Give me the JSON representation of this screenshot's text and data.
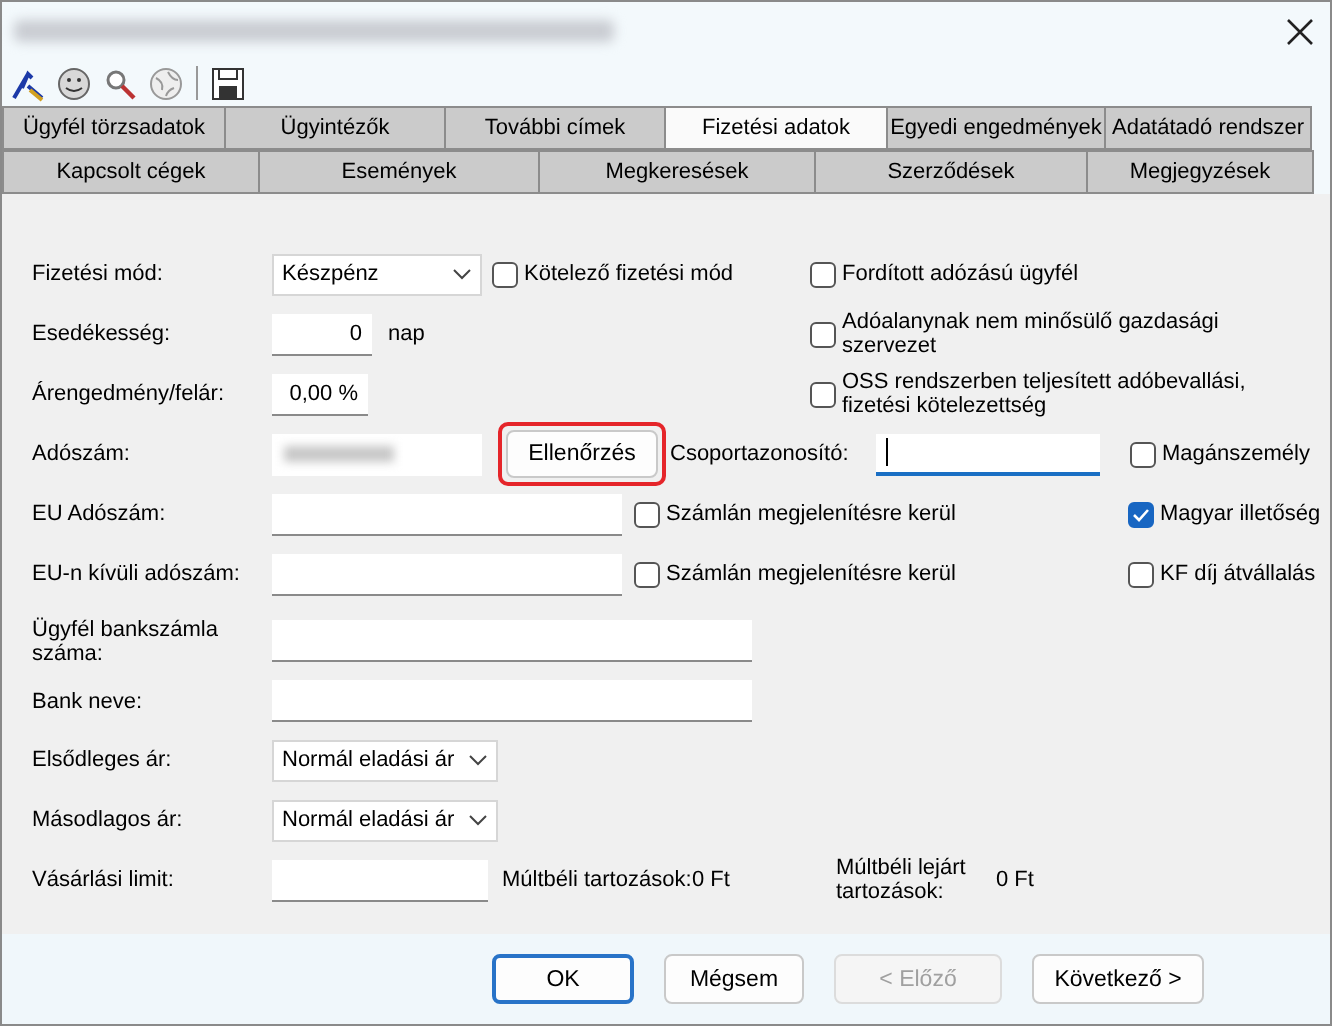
{
  "tabs": [
    [
      {
        "label": "Ügyfél törzsadatok",
        "selected": false
      },
      {
        "label": "Ügyintézők",
        "selected": false
      },
      {
        "label": "További címek",
        "selected": false
      },
      {
        "label": "Fizetési adatok",
        "selected": true
      },
      {
        "label": "Egyedi engedmények",
        "selected": false
      },
      {
        "label": "Adatátadó rendszer",
        "selected": false
      }
    ],
    [
      {
        "label": "Kapcsolt cégek",
        "selected": false
      },
      {
        "label": "Események",
        "selected": false
      },
      {
        "label": "Megkeresések",
        "selected": false
      },
      {
        "label": "Szerződések",
        "selected": false
      },
      {
        "label": "Megjegyzések",
        "selected": false
      }
    ]
  ],
  "form": {
    "rows": [
      {
        "items": [
          {
            "kind": "label",
            "text": "Fizetési mód:"
          },
          {
            "kind": "select",
            "value": "Készpénz"
          },
          {
            "kind": "checkbox",
            "label": "Kötelező fizetési mód",
            "checked": false
          },
          {
            "kind": "checkbox",
            "label": "Fordított adózású ügyfél",
            "checked": false
          }
        ]
      },
      {
        "items": [
          {
            "kind": "label",
            "text": "Esedékesség:"
          },
          {
            "kind": "number",
            "value": "0"
          },
          {
            "kind": "text",
            "text": "nap"
          },
          {
            "kind": "checkbox",
            "label": "Adóalanynak nem minősülő gazdasági szervezet",
            "checked": false
          }
        ]
      },
      {
        "items": [
          {
            "kind": "label",
            "text": "Árengedmény/felár:"
          },
          {
            "kind": "number",
            "value": "0,00 %"
          },
          {
            "kind": "checkbox",
            "label": "OSS rendszerben teljesített adóbevallási, fizetési kötelezettség",
            "checked": false
          }
        ]
      },
      {
        "items": [
          {
            "kind": "label",
            "text": "Adószám:"
          },
          {
            "kind": "redacted"
          },
          {
            "kind": "button",
            "label": "Ellenőrzés",
            "highlighted": true
          },
          {
            "kind": "text",
            "text": "Csoportazonosító:"
          },
          {
            "kind": "input",
            "value": "",
            "focused": true
          },
          {
            "kind": "checkbox",
            "label": "Magánszemély",
            "checked": false
          }
        ]
      },
      {
        "items": [
          {
            "kind": "label",
            "text": "EU Adószám:"
          },
          {
            "kind": "input",
            "value": "",
            "focused": false
          },
          {
            "kind": "checkbox",
            "label": "Számlán megjelenítésre kerül",
            "checked": false
          },
          {
            "kind": "checkbox",
            "label": "Magyar illetőség",
            "checked": true
          }
        ]
      },
      {
        "items": [
          {
            "kind": "label",
            "text": "EU-n kívüli adószám:"
          },
          {
            "kind": "input",
            "value": "",
            "focused": false
          },
          {
            "kind": "checkbox",
            "label": "Számlán megjelenítésre kerül",
            "checked": false
          },
          {
            "kind": "checkbox",
            "label": "KF díj átvállalás",
            "checked": false
          }
        ]
      },
      {
        "items": [
          {
            "kind": "label",
            "text": "Ügyfél bankszámla száma:"
          },
          {
            "kind": "input",
            "value": "",
            "focused": false
          }
        ]
      },
      {
        "items": [
          {
            "kind": "label",
            "text": "Bank neve:"
          },
          {
            "kind": "input",
            "value": "",
            "focused": false
          }
        ]
      },
      {
        "items": [
          {
            "kind": "label",
            "text": "Elsődleges ár:"
          },
          {
            "kind": "select",
            "value": "Normál eladási ár"
          }
        ]
      },
      {
        "items": [
          {
            "kind": "label",
            "text": "Másodlagos ár:"
          },
          {
            "kind": "select",
            "value": "Normál eladási ár"
          }
        ]
      },
      {
        "items": [
          {
            "kind": "label",
            "text": "Vásárlási limit:"
          },
          {
            "kind": "input",
            "value": "",
            "focused": false
          },
          {
            "kind": "text",
            "text": "Múltbéli tartozások:"
          },
          {
            "kind": "text",
            "text": "0 Ft"
          },
          {
            "kind": "text",
            "text": "Múltbéli lejárt tartozások:"
          },
          {
            "kind": "text",
            "text": "0 Ft"
          }
        ]
      }
    ]
  },
  "buttons": [
    {
      "label": "OK",
      "default": true,
      "disabled": false
    },
    {
      "label": "Mégsem",
      "default": false,
      "disabled": false
    },
    {
      "label": "< Előző",
      "default": false,
      "disabled": true
    },
    {
      "label": "Következő >",
      "default": false,
      "disabled": false
    }
  ]
}
